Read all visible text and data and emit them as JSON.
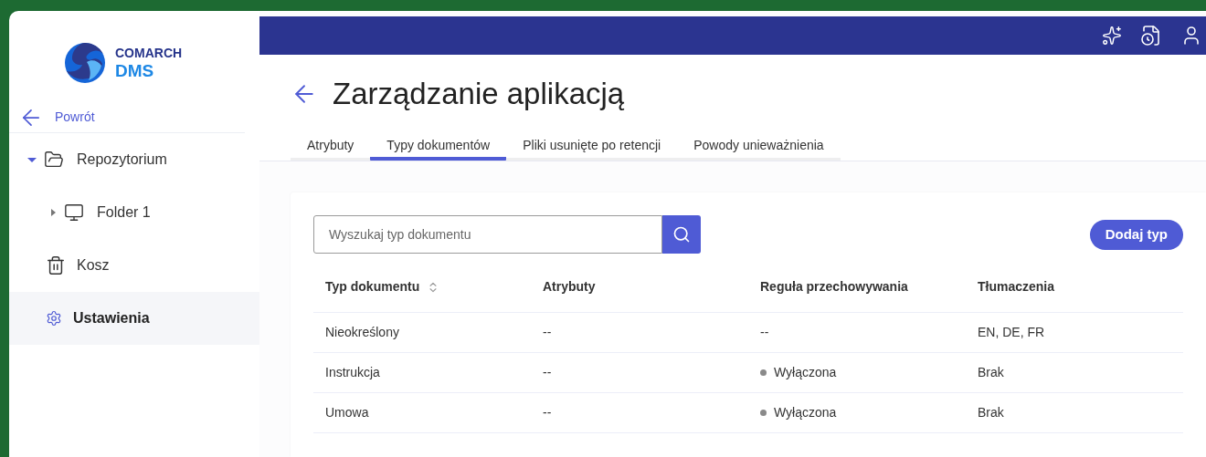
{
  "logo": {
    "line1": "COMARCH",
    "line2": "DMS"
  },
  "back_link": {
    "label": "Powrót"
  },
  "sidebar": {
    "tree": [
      {
        "label": "Repozytorium",
        "kind": "folder",
        "expanded": true,
        "children": [
          {
            "label": "Folder 1",
            "kind": "computer",
            "expanded": false
          }
        ]
      }
    ],
    "items": [
      {
        "label": "Kosz",
        "kind": "trash",
        "selected": false
      },
      {
        "label": "Ustawienia",
        "kind": "settings",
        "selected": true
      }
    ]
  },
  "page": {
    "title": "Zarządzanie aplikacją"
  },
  "tabs": [
    {
      "label": "Atrybuty",
      "selected": false
    },
    {
      "label": "Typy dokumentów",
      "selected": true
    },
    {
      "label": "Pliki usunięte po retencji",
      "selected": false
    },
    {
      "label": "Powody unieważnienia",
      "selected": false
    }
  ],
  "search": {
    "placeholder": "Wyszukaj typ dokumentu"
  },
  "add_button": {
    "label": "Dodaj typ"
  },
  "table": {
    "columns": [
      {
        "label": "Typ dokumentu",
        "sortable": true
      },
      {
        "label": "Atrybuty",
        "sortable": false
      },
      {
        "label": "Reguła przechowywania",
        "sortable": false
      },
      {
        "label": "Tłumaczenia",
        "sortable": false
      }
    ],
    "rows": [
      {
        "type": "Nieokreślony",
        "attributes": "--",
        "retention": {
          "kind": "plain",
          "text": "--"
        },
        "translations": "EN, DE, FR"
      },
      {
        "type": "Instrukcja",
        "attributes": "--",
        "retention": {
          "kind": "status",
          "text": "Wyłączona"
        },
        "translations": "Brak"
      },
      {
        "type": "Umowa",
        "attributes": "--",
        "retention": {
          "kind": "status",
          "text": "Wyłączona"
        },
        "translations": "Brak"
      }
    ]
  }
}
